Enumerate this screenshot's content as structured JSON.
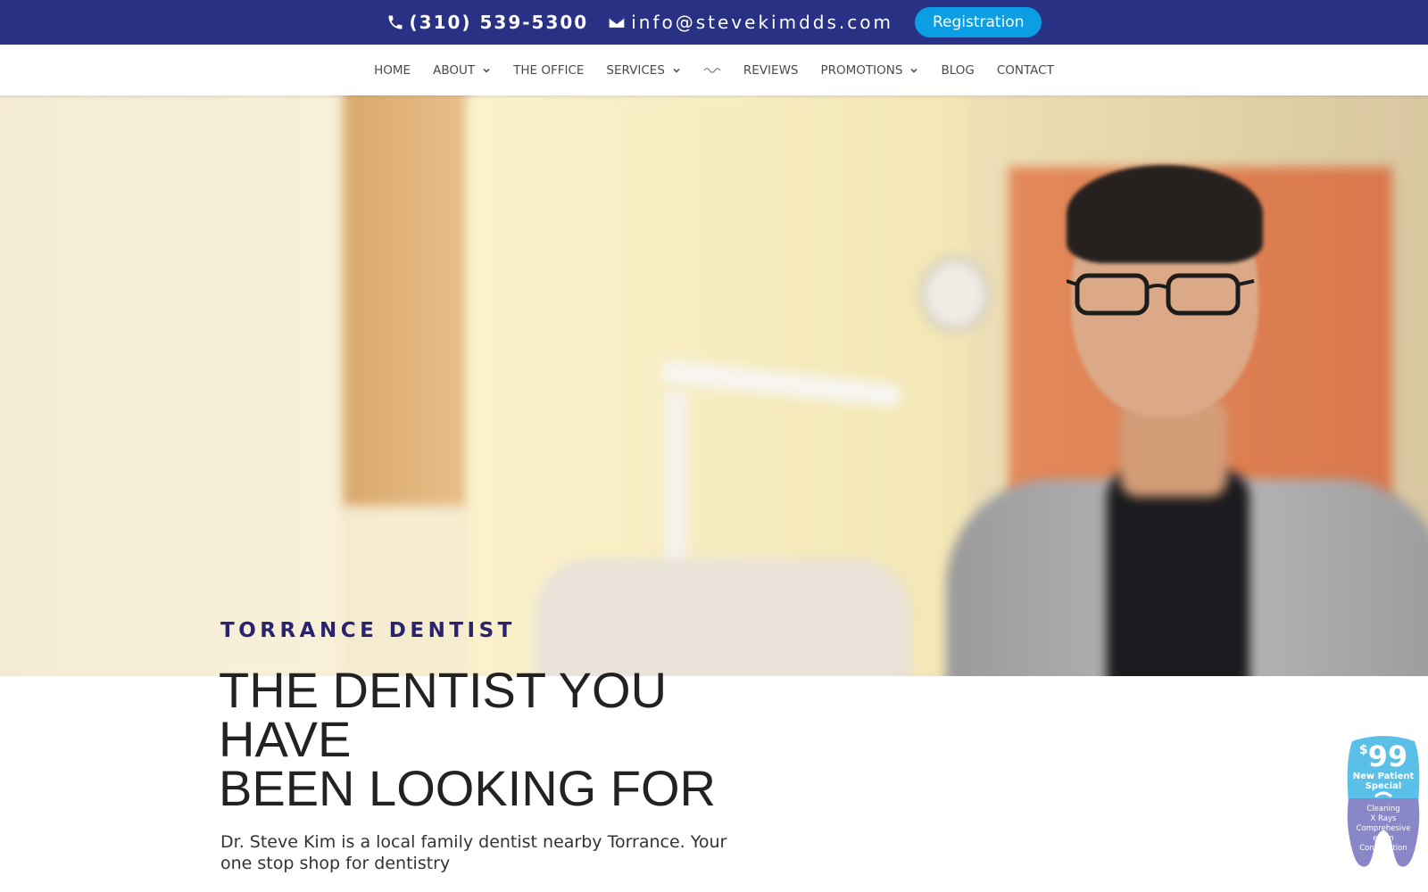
{
  "topbar": {
    "phone": "(310) 539-5300",
    "email": "info@stevekimdds.com",
    "registration_label": "Registration",
    "bg_color": "#283184",
    "button_color": "#0b9ee2"
  },
  "nav": {
    "items": [
      {
        "label": "HOME",
        "dropdown": false
      },
      {
        "label": "ABOUT",
        "dropdown": true
      },
      {
        "label": "THE OFFICE",
        "dropdown": false
      },
      {
        "label": "SERVICES",
        "dropdown": true
      },
      {
        "label": "REVIEWS",
        "dropdown": false
      },
      {
        "label": "PROMOTIONS",
        "dropdown": true
      },
      {
        "label": "BLOG",
        "dropdown": false
      },
      {
        "label": "CONTACT",
        "dropdown": false
      }
    ]
  },
  "hero": {
    "eyebrow": "TORRANCE DENTIST",
    "headline_line1": "THE DENTIST YOU",
    "headline_line2": "HAVE",
    "headline_line3": "BEEN LOOKING FOR",
    "subtext": "Dr. Steve Kim is a local family dentist nearby Torrance.  Your one stop shop for dentistry",
    "eyebrow_color": "#2a2370"
  },
  "badge": {
    "currency": "$",
    "price": "99",
    "title_line1": "New Patient",
    "title_line2": "Special",
    "items": [
      "Cleaning",
      "X Rays",
      "Comprehesive",
      "exam",
      "Consultation"
    ],
    "top_color": "#5bc0e8",
    "bottom_color": "#8a87c9"
  }
}
